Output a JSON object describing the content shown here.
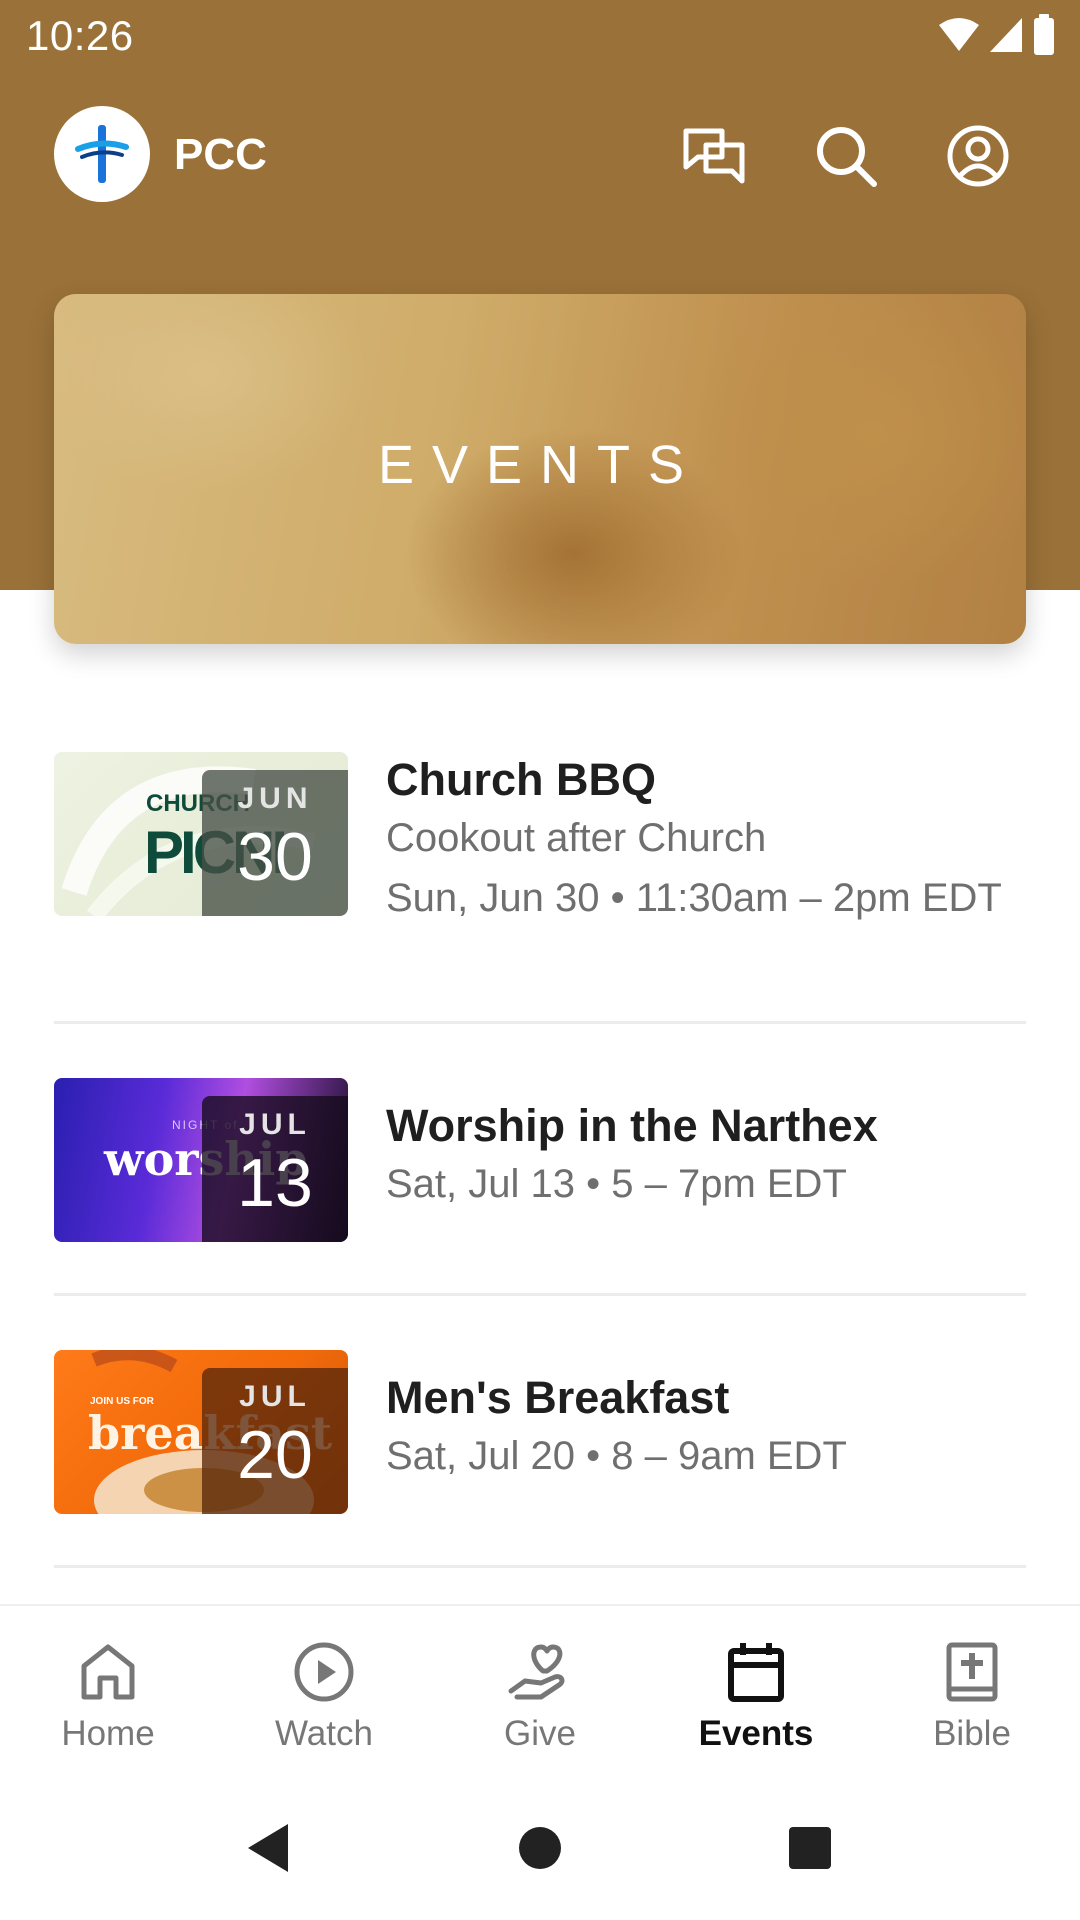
{
  "status_bar": {
    "time": "10:26"
  },
  "app_bar": {
    "org_name": "PCC"
  },
  "hero": {
    "title": "EVENTS"
  },
  "events": [
    {
      "title": "Church BBQ",
      "subtitle": "Cookout after Church",
      "datetime": "Sun, Jun 30 • 11:30am – 2pm EDT",
      "month": "JUN",
      "day": "30",
      "thumb_text_1": "CHURCH",
      "thumb_text_2": "PICNI"
    },
    {
      "title": "Worship in the Narthex",
      "datetime": "Sat, Jul 13 • 5 – 7pm EDT",
      "month": "JUL",
      "day": "13",
      "thumb_text_1": "NIGHT of",
      "thumb_text_2": "worship"
    },
    {
      "title": "Men's Breakfast",
      "datetime": "Sat, Jul 20 • 8 – 9am EDT",
      "month": "JUL",
      "day": "20",
      "thumb_text_1": "JOIN US FOR",
      "thumb_text_2": "breakfast"
    }
  ],
  "bottom_nav": {
    "items": [
      {
        "label": "Home",
        "icon": "home-icon"
      },
      {
        "label": "Watch",
        "icon": "play-circle-icon"
      },
      {
        "label": "Give",
        "icon": "give-heart-hand-icon"
      },
      {
        "label": "Events",
        "icon": "calendar-icon",
        "active": true
      },
      {
        "label": "Bible",
        "icon": "bible-icon"
      }
    ]
  },
  "colors": {
    "header": "#9a7138",
    "title_text": "#1f1f1f",
    "secondary_text": "#6f6f6f",
    "nav_inactive": "#777777",
    "nav_active": "#111111"
  }
}
